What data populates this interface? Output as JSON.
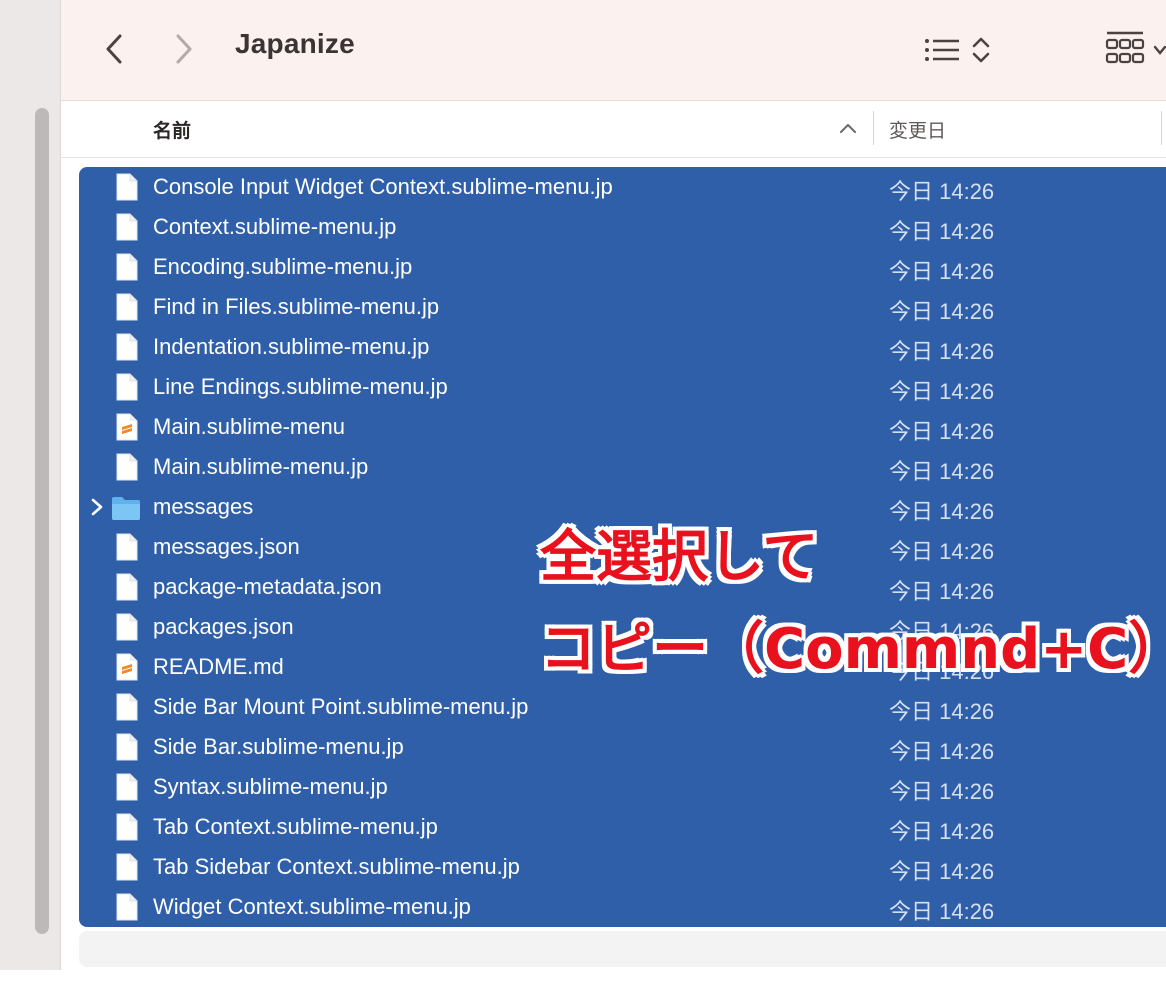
{
  "window": {
    "title": "Japanize"
  },
  "toolbar": {
    "back_icon": "chevron-left-icon",
    "forward_icon": "chevron-right-icon",
    "list_view_icon": "list-view-icon",
    "grid_view_icon": "grid-view-icon"
  },
  "columns": {
    "name": "名前",
    "date_modified": "変更日"
  },
  "files": [
    {
      "name": "Console Input Widget Context.sublime-menu.jp",
      "date": "今日 14:26",
      "kind": "doc"
    },
    {
      "name": "Context.sublime-menu.jp",
      "date": "今日 14:26",
      "kind": "doc"
    },
    {
      "name": "Encoding.sublime-menu.jp",
      "date": "今日 14:26",
      "kind": "doc"
    },
    {
      "name": "Find in Files.sublime-menu.jp",
      "date": "今日 14:26",
      "kind": "doc"
    },
    {
      "name": "Indentation.sublime-menu.jp",
      "date": "今日 14:26",
      "kind": "doc"
    },
    {
      "name": "Line Endings.sublime-menu.jp",
      "date": "今日 14:26",
      "kind": "doc"
    },
    {
      "name": "Main.sublime-menu",
      "date": "今日 14:26",
      "kind": "sublime"
    },
    {
      "name": "Main.sublime-menu.jp",
      "date": "今日 14:26",
      "kind": "doc"
    },
    {
      "name": "messages",
      "date": "今日 14:26",
      "kind": "folder"
    },
    {
      "name": "messages.json",
      "date": "今日 14:26",
      "kind": "doc"
    },
    {
      "name": "package-metadata.json",
      "date": "今日 14:26",
      "kind": "doc"
    },
    {
      "name": "packages.json",
      "date": "今日 14:26",
      "kind": "doc"
    },
    {
      "name": "README.md",
      "date": "今日 14:26",
      "kind": "sublime"
    },
    {
      "name": "Side Bar Mount Point.sublime-menu.jp",
      "date": "今日 14:26",
      "kind": "doc"
    },
    {
      "name": "Side Bar.sublime-menu.jp",
      "date": "今日 14:26",
      "kind": "doc"
    },
    {
      "name": "Syntax.sublime-menu.jp",
      "date": "今日 14:26",
      "kind": "doc"
    },
    {
      "name": "Tab Context.sublime-menu.jp",
      "date": "今日 14:26",
      "kind": "doc"
    },
    {
      "name": "Tab Sidebar Context.sublime-menu.jp",
      "date": "今日 14:26",
      "kind": "doc"
    },
    {
      "name": "Widget Context.sublime-menu.jp",
      "date": "今日 14:26",
      "kind": "doc"
    }
  ],
  "annotation": {
    "line1": "全選択して",
    "line2": "コピー（Commnd+C）"
  },
  "colors": {
    "selection": "#2f5fa8",
    "annotation_text": "#e8111d",
    "toolbar_bg": "#fbf1ee"
  }
}
